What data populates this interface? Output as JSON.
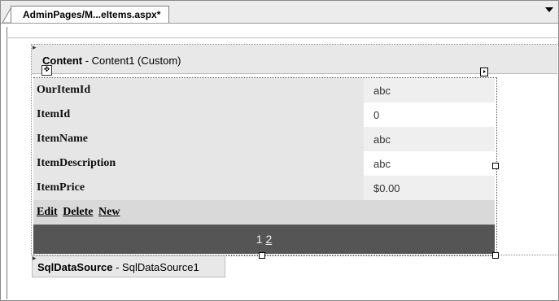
{
  "tab": {
    "title": "AdminPages/M...eItems.aspx*"
  },
  "content": {
    "name": "Content",
    "detail": " - Content1 (Custom)"
  },
  "detailsview": {
    "rows": [
      {
        "field": "OurItemId",
        "value": "abc"
      },
      {
        "field": "ItemId",
        "value": "0"
      },
      {
        "field": "ItemName",
        "value": "abc"
      },
      {
        "field": "ItemDescription",
        "value": "abc"
      },
      {
        "field": "ItemPrice",
        "value": "$0.00"
      }
    ],
    "commands": {
      "edit": "Edit",
      "delete": "Delete",
      "new": "New"
    },
    "pager": {
      "current": "1",
      "next": "2"
    }
  },
  "sqldatasource": {
    "name": "SqlDataSource",
    "detail": " - SqlDataSource1"
  },
  "icons": [
    "dropdown-arrow-icon",
    "move-handle-icon",
    "smart-tag-icon",
    "collapse-arrow-icon"
  ]
}
